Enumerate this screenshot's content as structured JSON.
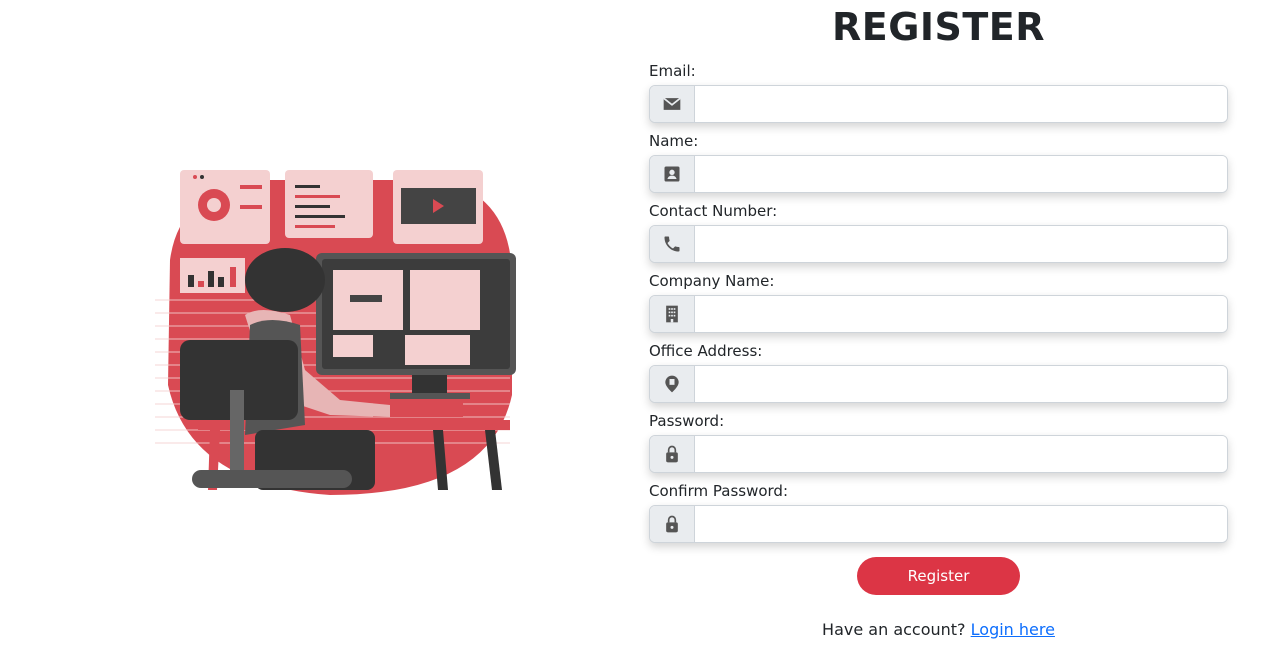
{
  "page": {
    "title": "REGISTER"
  },
  "fields": [
    {
      "id": "email",
      "label": "Email:",
      "value": "",
      "icon": "envelope-icon"
    },
    {
      "id": "name",
      "label": "Name:",
      "value": "",
      "icon": "person-badge-icon"
    },
    {
      "id": "contact",
      "label": "Contact Number:",
      "value": "",
      "icon": "phone-icon"
    },
    {
      "id": "company",
      "label": "Company Name:",
      "value": "",
      "icon": "building-icon"
    },
    {
      "id": "address",
      "label": "Office Address:",
      "value": "",
      "icon": "map-pin-icon"
    },
    {
      "id": "password",
      "label": "Password:",
      "value": "",
      "icon": "lock-icon"
    },
    {
      "id": "confirm",
      "label": "Confirm Password:",
      "value": "",
      "icon": "lock-icon"
    }
  ],
  "actions": {
    "register_label": "Register"
  },
  "footer": {
    "prompt": "Have an account?",
    "link_label": "Login here"
  },
  "colors": {
    "accent": "#dc3545",
    "link": "#0d6efd",
    "illustration_red": "#d94a53",
    "illustration_pink": "#f4d0d0",
    "illustration_dark": "#333333"
  }
}
